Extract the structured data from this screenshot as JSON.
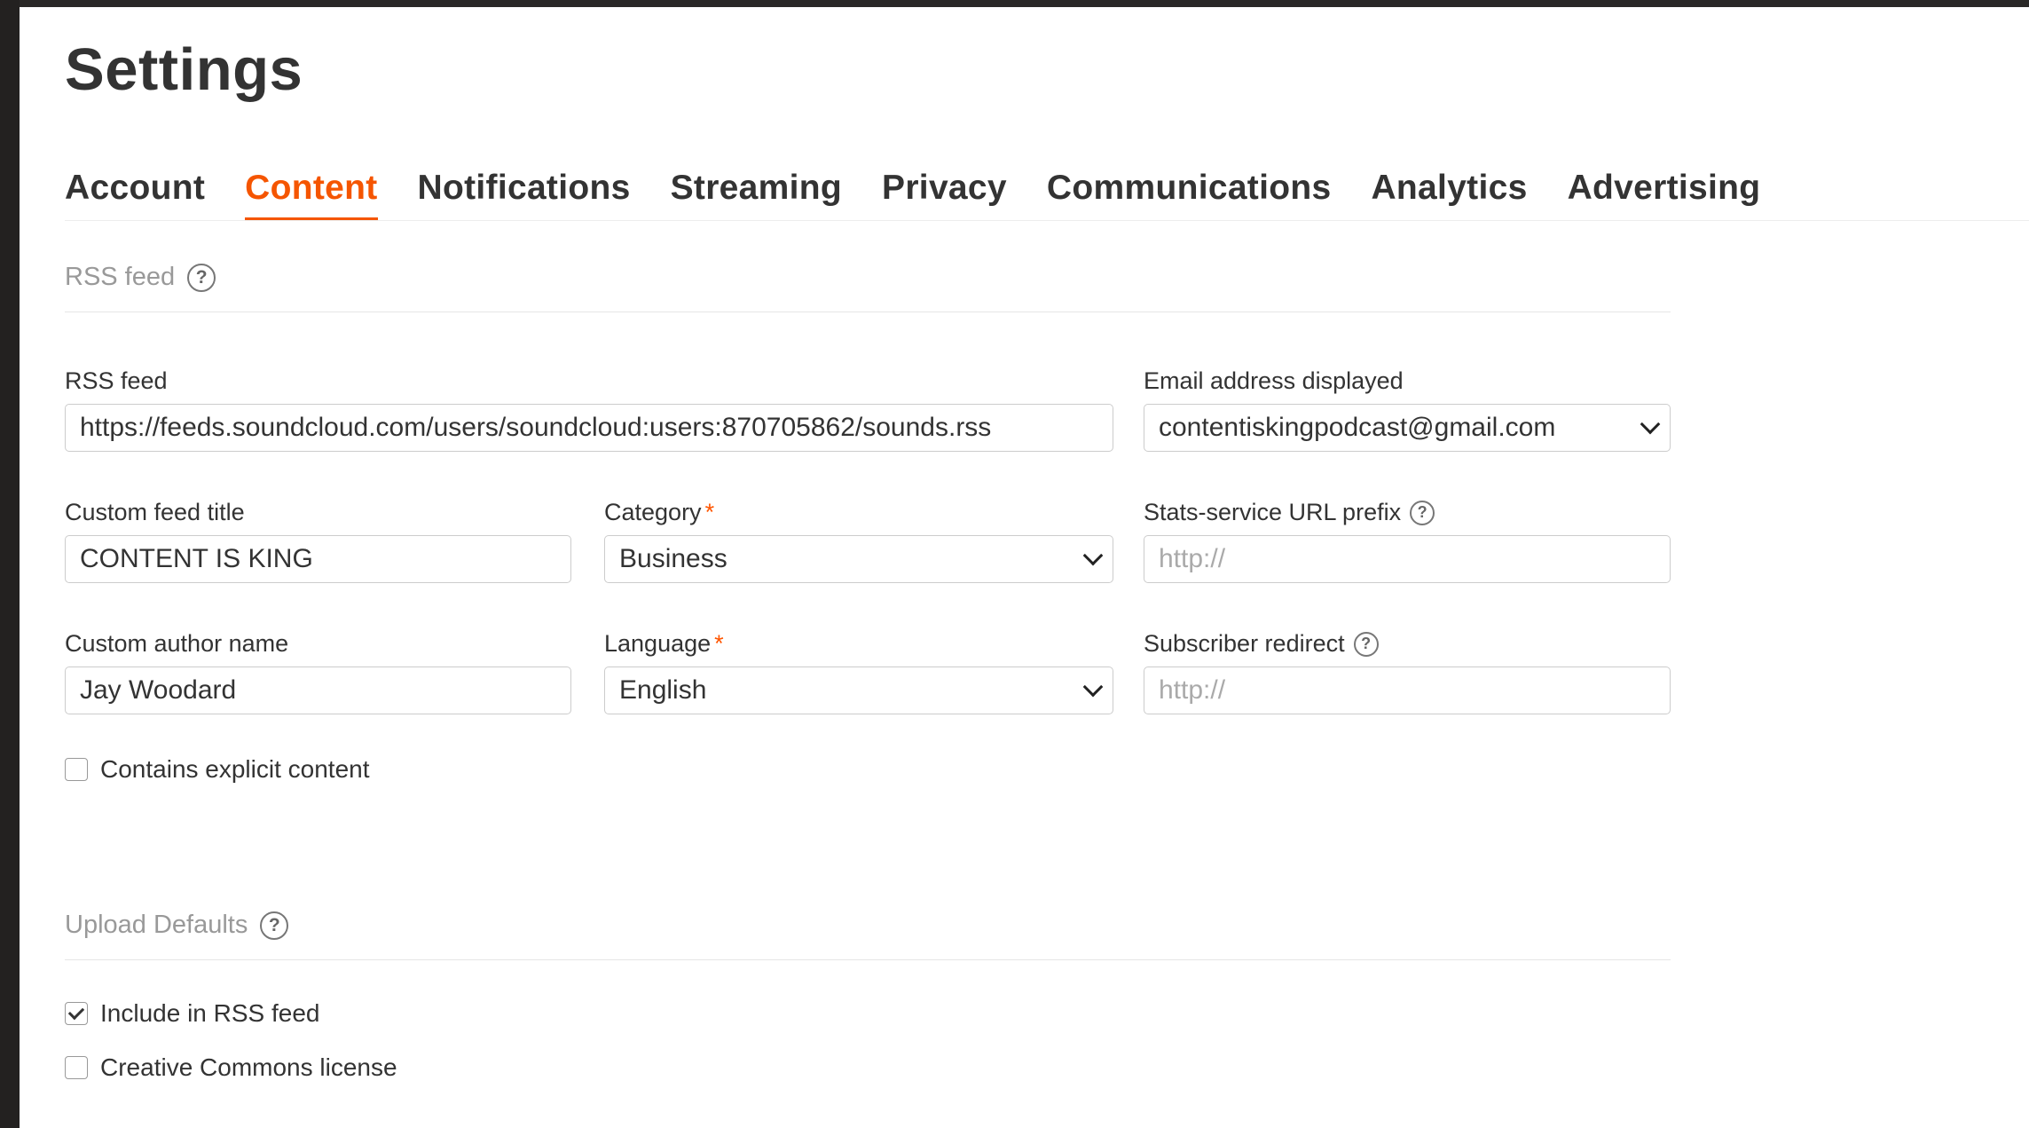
{
  "page": {
    "title": "Settings"
  },
  "tabs": [
    {
      "label": "Account",
      "active": false
    },
    {
      "label": "Content",
      "active": true
    },
    {
      "label": "Notifications",
      "active": false
    },
    {
      "label": "Streaming",
      "active": false
    },
    {
      "label": "Privacy",
      "active": false
    },
    {
      "label": "Communications",
      "active": false
    },
    {
      "label": "Analytics",
      "active": false
    },
    {
      "label": "Advertising",
      "active": false
    }
  ],
  "rss_section": {
    "heading": "RSS feed",
    "help_icon": "question-circle-icon",
    "rss_feed": {
      "label": "RSS feed",
      "value": "https://feeds.soundcloud.com/users/soundcloud:users:870705862/sounds.rss"
    },
    "email": {
      "label": "Email address displayed",
      "value": "contentiskingpodcast@gmail.com"
    },
    "custom_title": {
      "label": "Custom feed title",
      "value": "CONTENT IS KING"
    },
    "category": {
      "label": "Category",
      "required_mark": "*",
      "value": "Business"
    },
    "stats_prefix": {
      "label": "Stats-service URL prefix",
      "placeholder": "http://"
    },
    "author": {
      "label": "Custom author name",
      "value": "Jay Woodard"
    },
    "language": {
      "label": "Language",
      "required_mark": "*",
      "value": "English"
    },
    "subscriber_redirect": {
      "label": "Subscriber redirect",
      "placeholder": "http://"
    },
    "explicit": {
      "label": "Contains explicit content",
      "checked": false
    }
  },
  "upload_section": {
    "heading": "Upload Defaults",
    "help_icon": "question-circle-icon",
    "include_rss": {
      "label": "Include in RSS feed",
      "checked": true
    },
    "creative_commons": {
      "label": "Creative Commons license",
      "checked": false
    }
  },
  "colors": {
    "accent": "#f55500",
    "text": "#333333",
    "muted": "#999999",
    "border": "#cccccc"
  }
}
